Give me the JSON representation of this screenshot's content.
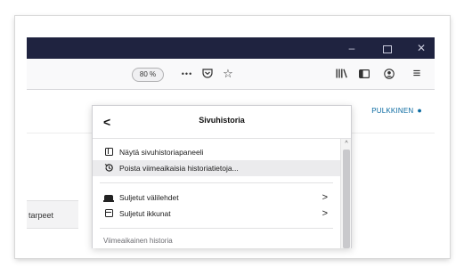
{
  "window_controls": {
    "minimize": "–",
    "restore": "ロ",
    "close": "✕"
  },
  "toolbar": {
    "zoom_level": "80 %",
    "more_icon": "•••",
    "pocket_icon": "pocket-icon",
    "bookmark_icon": "☆",
    "library_icon": "library-icon",
    "sidebar_icon": "sidebar-icon",
    "account_icon": "account-icon",
    "menu_icon": "≡"
  },
  "page": {
    "user_name": "PULKKINEN",
    "left_tab_label": "tarpeet"
  },
  "panel": {
    "title": "Sivuhistoria",
    "back_label": "<",
    "items": [
      {
        "label": "Näytä sivuhistoriapaneeli",
        "icon": "sidebar-panel-icon"
      },
      {
        "label": "Poista viimeaikaisia historiatietoja...",
        "icon": "history-clear-icon"
      },
      {
        "label": "Suljetut välilehdet",
        "icon": "closed-tabs-icon",
        "arrow": ">"
      },
      {
        "label": "Suljetut ikkunat",
        "icon": "closed-windows-icon",
        "arrow": ">"
      }
    ],
    "section_label": "Viimeaikainen historia"
  },
  "colors": {
    "titlebar": "#1f2340",
    "link_blue": "#0a6aa1",
    "hover": "#ebebed"
  }
}
